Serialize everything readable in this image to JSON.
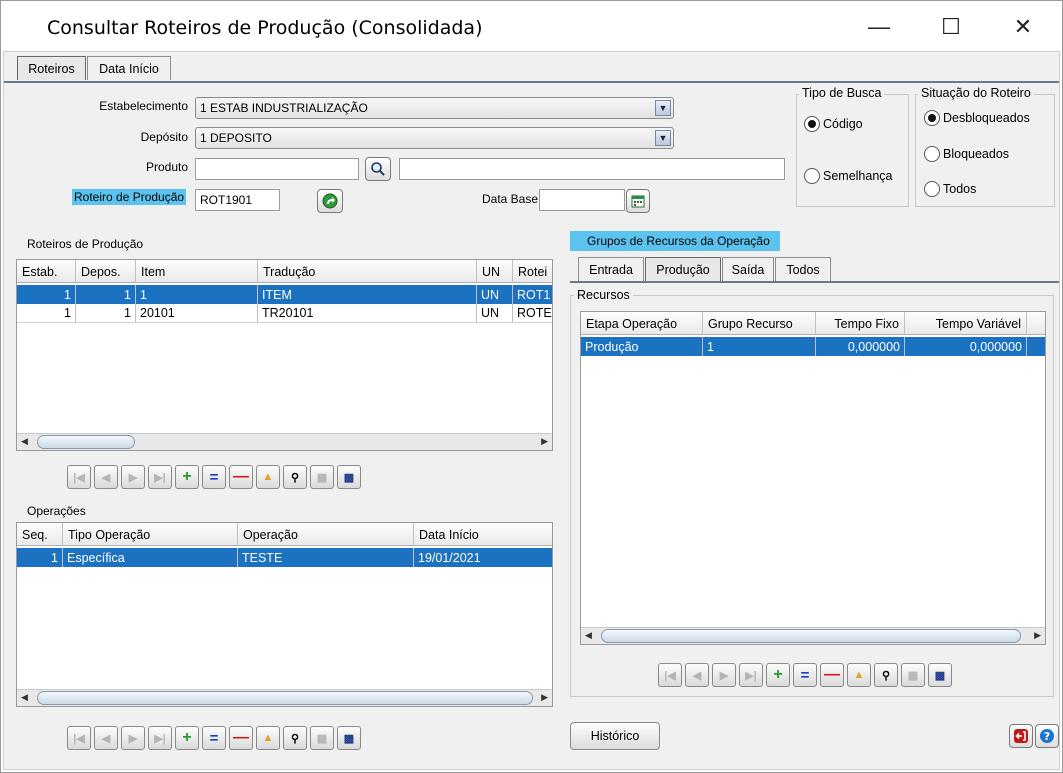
{
  "window": {
    "title": "Consultar Roteiros de Produção (Consolidada)",
    "minimize_icon": "minimize-icon",
    "maximize_icon": "maximize-icon",
    "close_icon": "close-icon"
  },
  "top_tabs": [
    {
      "label": "Roteiros",
      "active": true
    },
    {
      "label": "Data Início",
      "active": false
    }
  ],
  "form": {
    "estabelecimento_label": "Estabelecimento",
    "estabelecimento_value": "1 ESTAB INDUSTRIALIZAÇÃO",
    "deposito_label": "Depósito",
    "deposito_value": "1 DEPOSITO",
    "produto_label": "Produto",
    "produto_value": "",
    "produto_desc_value": "",
    "roteiro_label": "Roteiro de Produção",
    "roteiro_value": "ROT1901",
    "data_base_label": "Data Base",
    "data_base_value": ""
  },
  "tipo_busca": {
    "title": "Tipo de Busca",
    "options": [
      {
        "label": "Código",
        "selected": true
      },
      {
        "label": "Semelhança",
        "selected": false
      }
    ]
  },
  "situacao": {
    "title": "Situação do Roteiro",
    "options": [
      {
        "label": "Desbloqueados",
        "selected": true
      },
      {
        "label": "Bloqueados",
        "selected": false
      },
      {
        "label": "Todos",
        "selected": false
      }
    ]
  },
  "roteiros": {
    "title": "Roteiros de Produção",
    "columns": [
      "Estab.",
      "Depos.",
      "Item",
      "Tradução",
      "UN",
      "Rotei"
    ],
    "rows": [
      {
        "estab": "1",
        "depos": "1",
        "item": "1",
        "traducao": "ITEM",
        "un": "UN",
        "rot": "ROT1"
      },
      {
        "estab": "1",
        "depos": "1",
        "item": "20101",
        "traducao": "TR20101",
        "un": "UN",
        "rot": "ROTE"
      }
    ]
  },
  "operacoes": {
    "title": "Operações",
    "columns": [
      "Seq.",
      "Tipo Operação",
      "Operação",
      "Data Início"
    ],
    "rows": [
      {
        "seq": "1",
        "tipo": "Específica",
        "operacao": "TESTE",
        "data": "19/01/2021"
      }
    ]
  },
  "grupos": {
    "title": "Grupos de Recursos da Operação",
    "tabs": [
      {
        "label": "Entrada",
        "active": false
      },
      {
        "label": "Produção",
        "active": true
      },
      {
        "label": "Saída",
        "active": false
      },
      {
        "label": "Todos",
        "active": false
      }
    ],
    "recursos_title": "Recursos",
    "columns": [
      "Etapa Operação",
      "Grupo Recurso",
      "Tempo Fixo",
      "Tempo Variável"
    ],
    "rows": [
      {
        "etapa": "Produção",
        "grupo": "1",
        "fixo": "0,000000",
        "variavel": "0,000000"
      }
    ]
  },
  "buttons": {
    "historico": "Histórico"
  }
}
